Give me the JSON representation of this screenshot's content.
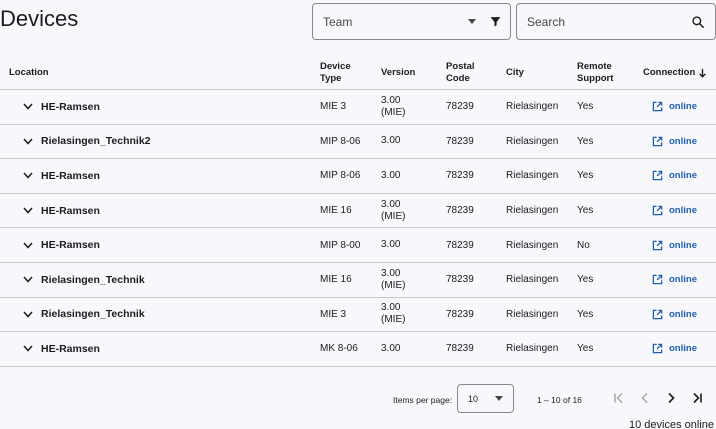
{
  "header": {
    "title": "Devices",
    "team_filter_label": "Team",
    "search_placeholder": "Search"
  },
  "table": {
    "columns": {
      "location": "Location",
      "device_type_1": "Device",
      "device_type_2": "Type",
      "version": "Version",
      "postal_1": "Postal",
      "postal_2": "Code",
      "city": "City",
      "remote_1": "Remote",
      "remote_2": "Support",
      "connection": "Connection"
    },
    "rows": [
      {
        "location": "HE-Ramsen",
        "type": "MIE 3",
        "version_1": "3.00",
        "version_2": "(MIE)",
        "postal": "78239",
        "city": "Rielasingen",
        "remote": "Yes",
        "connection": "online"
      },
      {
        "location": "Rielasingen_Technik2",
        "type": "MIP 8-06",
        "version_1": "3.00",
        "version_2": "",
        "postal": "78239",
        "city": "Rielasingen",
        "remote": "Yes",
        "connection": "online"
      },
      {
        "location": "HE-Ramsen",
        "type": "MIP 8-06",
        "version_1": "3.00",
        "version_2": "",
        "postal": "78239",
        "city": "Rielasingen",
        "remote": "Yes",
        "connection": "online"
      },
      {
        "location": "HE-Ramsen",
        "type": "MIE 16",
        "version_1": "3.00",
        "version_2": "(MIE)",
        "postal": "78239",
        "city": "Rielasingen",
        "remote": "Yes",
        "connection": "online"
      },
      {
        "location": "HE-Ramsen",
        "type": "MIP 8-00",
        "version_1": "3.00",
        "version_2": "",
        "postal": "78239",
        "city": "Rielasingen",
        "remote": "No",
        "connection": "online"
      },
      {
        "location": "Rielasingen_Technik",
        "type": "MIE 16",
        "version_1": "3.00",
        "version_2": "(MIE)",
        "postal": "78239",
        "city": "Rielasingen",
        "remote": "Yes",
        "connection": "online"
      },
      {
        "location": "Rielasingen_Technik",
        "type": "MIE 3",
        "version_1": "3.00",
        "version_2": "(MIE)",
        "postal": "78239",
        "city": "Rielasingen",
        "remote": "Yes",
        "connection": "online"
      },
      {
        "location": "HE-Ramsen",
        "type": "MK 8-06",
        "version_1": "3.00",
        "version_2": "",
        "postal": "78239",
        "city": "Rielasingen",
        "remote": "Yes",
        "connection": "online"
      }
    ]
  },
  "paginator": {
    "items_per_page_label": "Items per page:",
    "items_per_page_value": "10",
    "range_label": "1 – 10 of 16"
  },
  "footer": {
    "devices_online": "10 devices online"
  },
  "colors": {
    "accent": "#1f5fb0",
    "background": "#f8f7fc",
    "divider": "#c9c5cd"
  }
}
